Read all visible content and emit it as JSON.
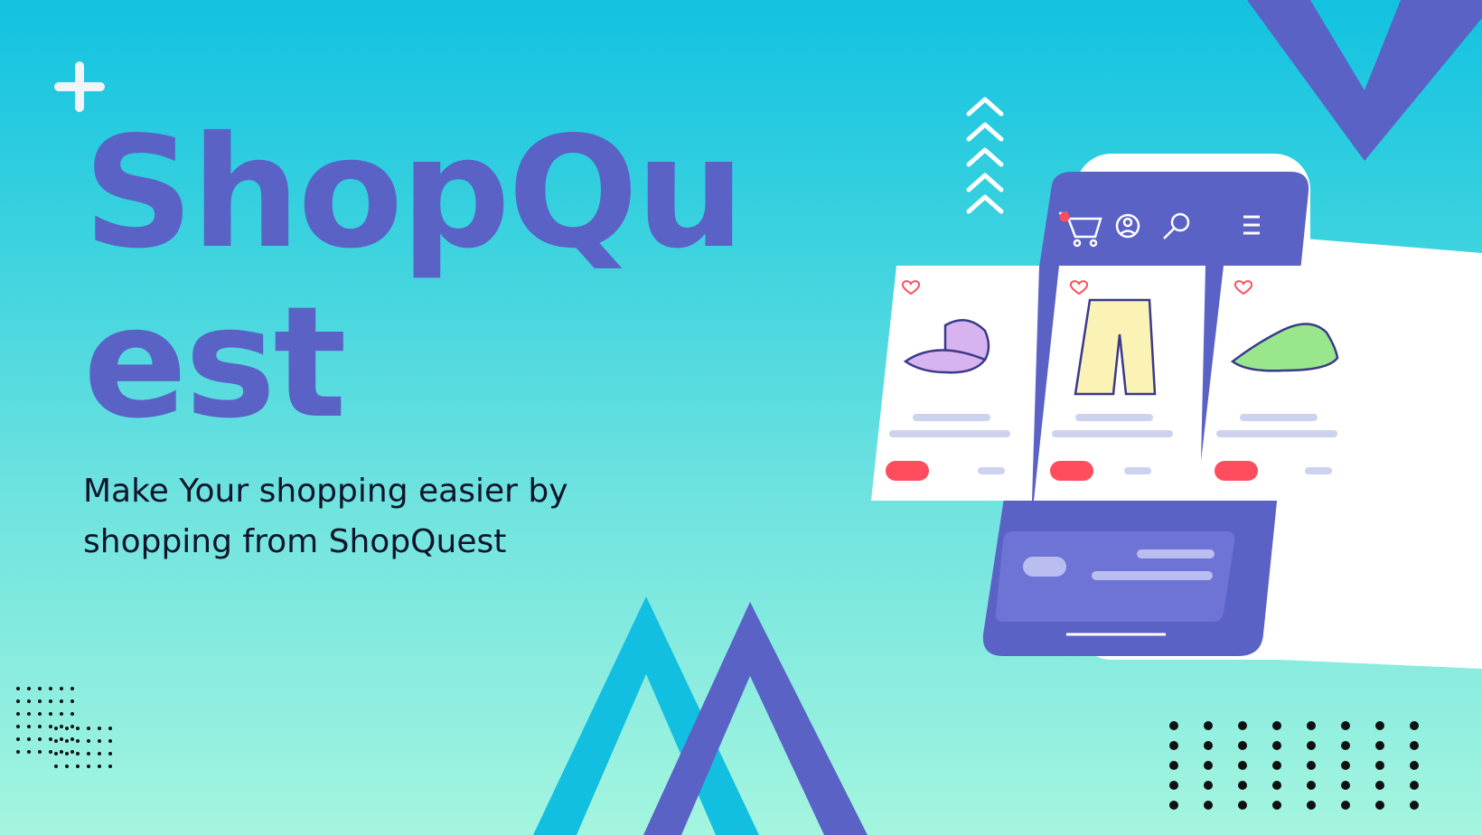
{
  "hero": {
    "title": "ShopQu\nest",
    "subtitle": "Make Your shopping easier by shopping from ShopQuest"
  },
  "colors": {
    "brand_purple": "#5a62c6",
    "cyan": "#12bfe0",
    "cart_red": "#ff4d5e"
  },
  "illustration": {
    "icons": [
      "plus-icon",
      "chevron-up-icon",
      "cart-icon",
      "user-icon",
      "search-icon",
      "menu-icon",
      "heart-icon"
    ],
    "products": [
      {
        "name": "cap"
      },
      {
        "name": "shorts"
      },
      {
        "name": "sneaker"
      }
    ]
  }
}
